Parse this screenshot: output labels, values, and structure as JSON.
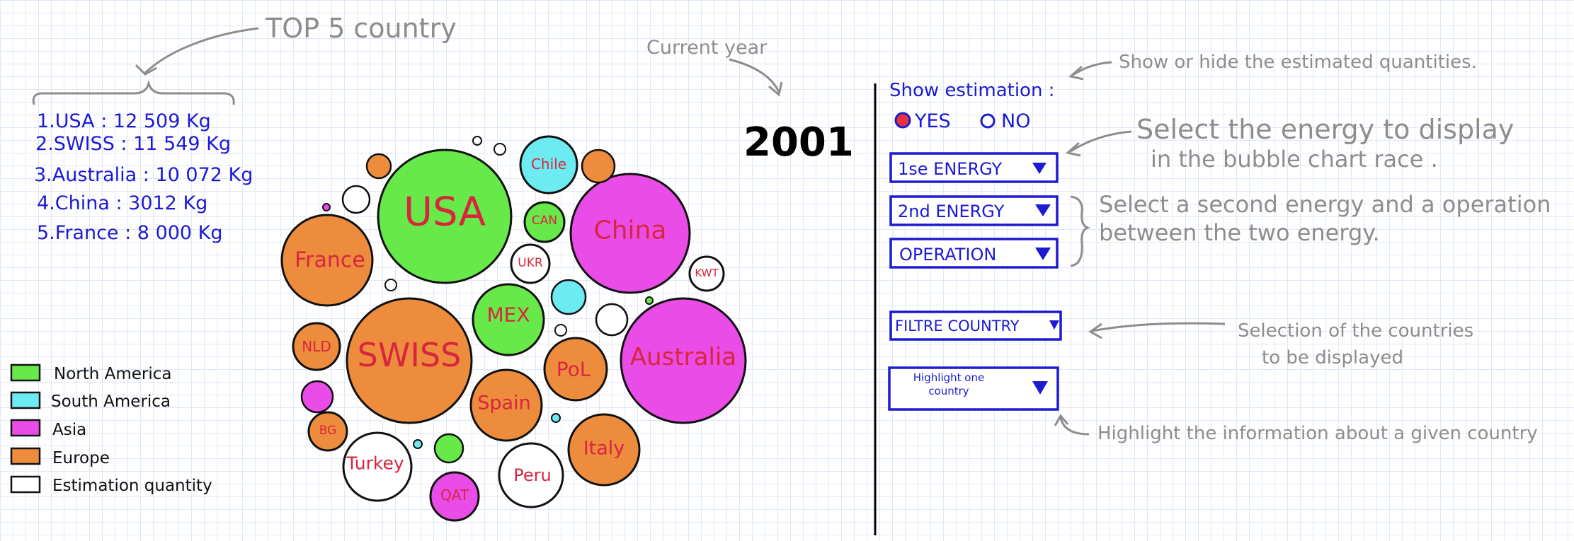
{
  "top5": {
    "title": "TOP 5 country",
    "items": [
      "1.USA : 12 509 Kg",
      "2.SWISS : 11 549 Kg",
      "3.Australia : 10 072 Kg",
      "4.China : 3012 Kg",
      "5.France : 8 000 Kg"
    ]
  },
  "legend": {
    "items": [
      {
        "label": "North America",
        "color": "#67ea49"
      },
      {
        "label": "South America",
        "color": "#6cecf2"
      },
      {
        "label": "Asia",
        "color": "#ea4ce8"
      },
      {
        "label": "Europe",
        "color": "#ee8c3e"
      },
      {
        "label": "Estimation quantity",
        "color": "#ffffff"
      }
    ]
  },
  "current_year": {
    "annotation": "Current year",
    "value": "2001"
  },
  "bubbles": [
    {
      "label": "USA",
      "region": "North America"
    },
    {
      "label": "SWISS",
      "region": "Europe"
    },
    {
      "label": "Australia",
      "region": "Asia"
    },
    {
      "label": "China",
      "region": "Asia"
    },
    {
      "label": "France",
      "region": "Europe"
    },
    {
      "label": "Chile",
      "region": "South America"
    },
    {
      "label": "CAN",
      "region": "North America"
    },
    {
      "label": "UKR",
      "region": "Estimation quantity"
    },
    {
      "label": "KWT",
      "region": "Estimation quantity"
    },
    {
      "label": "MEX",
      "region": "North America"
    },
    {
      "label": "NLD",
      "region": "Europe"
    },
    {
      "label": "PoL",
      "region": "Europe"
    },
    {
      "label": "Spain",
      "region": "Europe"
    },
    {
      "label": "Italy",
      "region": "Europe"
    },
    {
      "label": "BG",
      "region": "Europe"
    },
    {
      "label": "Turkey",
      "region": "Estimation quantity"
    },
    {
      "label": "Peru",
      "region": "Estimation quantity"
    },
    {
      "label": "QAT",
      "region": "Asia"
    }
  ],
  "controls": {
    "show_estimation_label": "Show estimation :",
    "yes_label": "YES",
    "no_label": "NO",
    "selected_option": "YES",
    "energy1": "1se ENERGY",
    "energy2": "2nd ENERGY",
    "operation": "OPERATION",
    "filter_country": "FILTRE COUNTRY",
    "highlight_line1": "Highlight one",
    "highlight_line2": "country"
  },
  "annotations": {
    "estimation": "Show or hide the estimated quantities.",
    "energy_line1": "Select the energy to display",
    "energy_line2": "in the bubble chart race .",
    "second_line1": "Select a second energy and a operation",
    "second_line2": "between the two energy.",
    "selection_line1": "Selection of the countries",
    "selection_line2": "to be displayed",
    "highlight": "Highlight the information about a given country"
  },
  "colors": {
    "north_america": "#67ea49",
    "south_america": "#6cecf2",
    "asia": "#ea4ce8",
    "europe": "#ee8c3e",
    "estimation": "#ffffff",
    "label_red": "#d7263d",
    "control_blue": "#1c1ad2",
    "annotation_gray": "#8d8d8d"
  }
}
